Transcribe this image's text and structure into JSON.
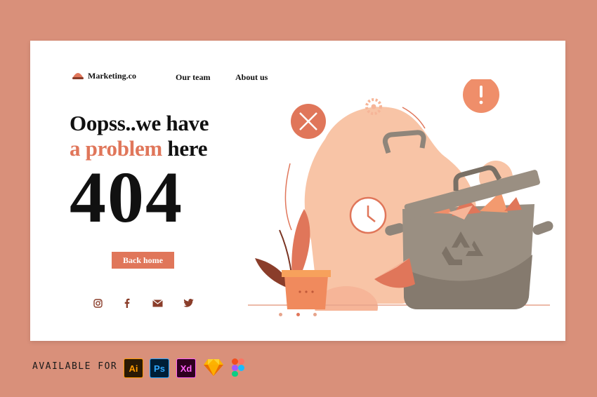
{
  "brand": {
    "name": "Marketing.co"
  },
  "nav": {
    "items": [
      {
        "label": "Our team"
      },
      {
        "label": "About us"
      }
    ]
  },
  "hero": {
    "line1": "Oopss..we have",
    "line2_accent": "a problem",
    "line2_rest": "here",
    "code": "404",
    "cta": "Back home"
  },
  "social": {
    "icons": [
      "instagram-icon",
      "facebook-icon",
      "mail-icon",
      "twitter-icon"
    ]
  },
  "pager": {
    "count": 3,
    "active_index": 1
  },
  "footer": {
    "label": "AVAILABLE FOR :",
    "tools": [
      {
        "name": "adobe-illustrator-icon",
        "text": "Ai"
      },
      {
        "name": "adobe-photoshop-icon",
        "text": "Ps"
      },
      {
        "name": "adobe-xd-icon",
        "text": "Xd"
      },
      {
        "name": "sketch-icon",
        "text": ""
      },
      {
        "name": "figma-icon",
        "text": ""
      }
    ]
  },
  "colors": {
    "background": "#d9907a",
    "accent": "#e0765a",
    "peach": "#f8c4a6",
    "bin": "#9a8f82"
  }
}
